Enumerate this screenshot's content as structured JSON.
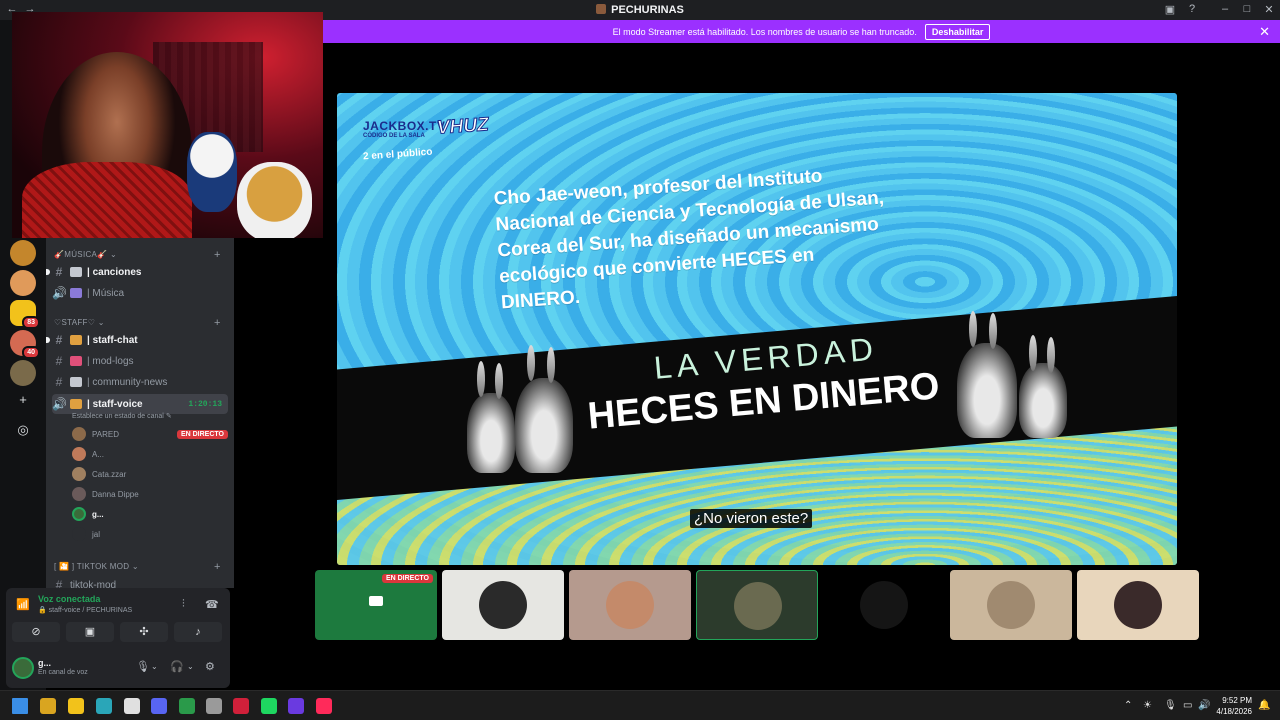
{
  "window": {
    "title": "PECHURINAS"
  },
  "banner": {
    "message": "El modo Streamer está habilitado. Los nombres de usuario se han truncado.",
    "button": "Deshabilitar"
  },
  "servers": [
    {
      "name": "server-1",
      "color": "#c4862c",
      "badge": ""
    },
    {
      "name": "server-2",
      "color": "#e09a5a",
      "badge": ""
    },
    {
      "name": "server-3",
      "color": "#f2c21b",
      "badge": "83"
    },
    {
      "name": "server-4",
      "color": "#d46a52",
      "badge": "40"
    },
    {
      "name": "server-5",
      "color": "#7a6a4a",
      "badge": ""
    }
  ],
  "sidebar": {
    "cat_musica": "🎸MÚSICA🎸",
    "ch_canciones": "| canciones",
    "ch_musica": "| Música",
    "cat_staff": "♡STAFF♡",
    "ch_staff_chat": "| staff-chat",
    "ch_mod_logs": "| mod-logs",
    "ch_community_news": "| community-news",
    "ch_staff_voice": "| staff-voice",
    "voice_time": "1:20:13",
    "voice_status": "Establece un estado de canal",
    "members": [
      {
        "name": "PARED",
        "live": true,
        "color": "#8c6a4a"
      },
      {
        "name": "A...",
        "live": false,
        "color": "#c07a5a"
      },
      {
        "name": "Cata.zzar",
        "live": false,
        "color": "#a08060"
      },
      {
        "name": "Danna Dippe",
        "live": false,
        "color": "#6a5a5a"
      },
      {
        "name": "g...",
        "live": false,
        "color": "#3a6b3a"
      },
      {
        "name": "jal",
        "live": false,
        "color": "#2b2d31"
      }
    ],
    "live_label": "EN DIRECTO",
    "cat_tiktok": "[ 🎦 ] TIKTOK MOD",
    "ch_tiktok_mod": "tiktok-mod"
  },
  "voice_panel": {
    "status": "Voz conectada",
    "location": "staff-voice / PECHURINAS"
  },
  "user_panel": {
    "name": "g...",
    "status": "En canal de voz"
  },
  "stream": {
    "jackbox": "JACKBOX.TV",
    "room_label": "CÓDIGO DE LA SALA",
    "room_code": "VHUZ",
    "audience": "2 en el público",
    "fact": "Cho Jae-weon, profesor del Instituto Nacional de Ciencia y Tecnología de Ulsan, Corea del Sur, ha diseñado un mecanismo ecológico que convierte HECES en DINERO.",
    "band_top": "LA VERDAD",
    "band_bottom": "HECES EN DINERO",
    "caption": "¿No vieron este?"
  },
  "tiles": [
    {
      "name": "tile-screen",
      "bg": "#1d7a3e",
      "circle": "",
      "live": true
    },
    {
      "name": "tile-2",
      "bg": "#e6e6e2",
      "circle": "#2a2a2a",
      "live": false
    },
    {
      "name": "tile-3",
      "bg": "#b59a8e",
      "circle": "#c48a6a",
      "live": false
    },
    {
      "name": "tile-4",
      "bg": "#2c3b2c",
      "circle": "#6a6a50",
      "live": false,
      "speaking": true
    },
    {
      "name": "tile-5",
      "bg": "#000000",
      "circle": "#151515",
      "live": false
    },
    {
      "name": "tile-6",
      "bg": "#cbb79c",
      "circle": "#a08a70",
      "live": false
    },
    {
      "name": "tile-7",
      "bg": "#e8d6bc",
      "circle": "#3a2a2a",
      "live": false
    }
  ],
  "tile_live_label": "EN DIRECTO",
  "taskbar": {
    "time": "9:52 PM",
    "date": "4/18/2026",
    "apps": [
      {
        "name": "start",
        "color": "#3a8ee6"
      },
      {
        "name": "app-2",
        "color": "#d9a520"
      },
      {
        "name": "file-explorer",
        "color": "#f2c21b"
      },
      {
        "name": "app-4",
        "color": "#2aa6b8"
      },
      {
        "name": "app-5",
        "color": "#e0e0e0"
      },
      {
        "name": "discord",
        "color": "#5865f2"
      },
      {
        "name": "chrome",
        "color": "#2a9a4a"
      },
      {
        "name": "app-8",
        "color": "#9a9a9a"
      },
      {
        "name": "app-9",
        "color": "#d0203a"
      },
      {
        "name": "spotify",
        "color": "#1ed760"
      },
      {
        "name": "app-11",
        "color": "#6a3ae0"
      },
      {
        "name": "tiktok",
        "color": "#ff2a5a"
      }
    ]
  }
}
